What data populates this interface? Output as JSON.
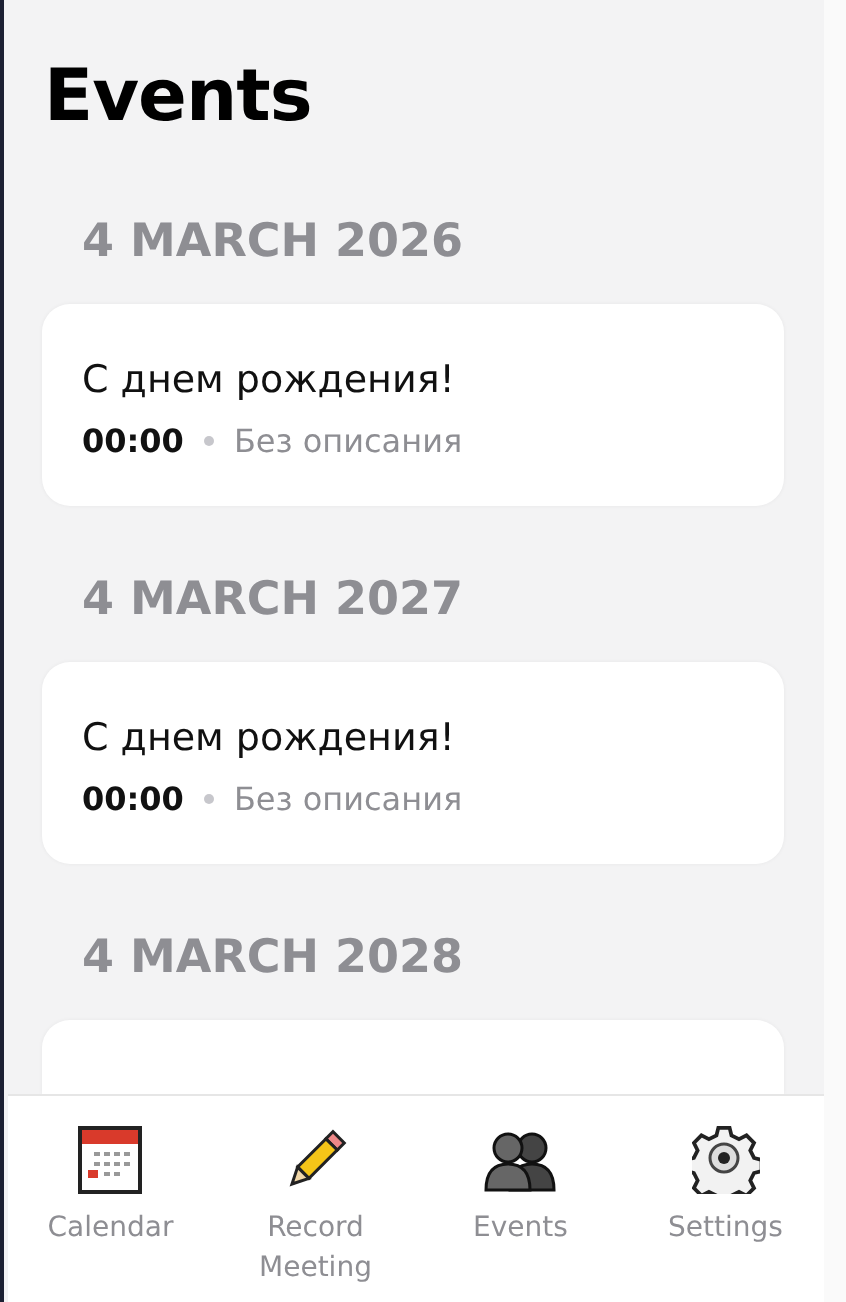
{
  "title": "Events",
  "sections": [
    {
      "date": "4 MARCH 2026",
      "events": [
        {
          "title": "С днем рождения!",
          "time": "00:00",
          "description": "Без описания"
        }
      ]
    },
    {
      "date": "4 MARCH 2027",
      "events": [
        {
          "title": "С днем рождения!",
          "time": "00:00",
          "description": "Без описания"
        }
      ]
    },
    {
      "date": "4 MARCH 2028",
      "events": [
        {
          "kind": "covered"
        }
      ]
    }
  ],
  "tab_bar": [
    {
      "kind": "calendar",
      "label": "Calendar"
    },
    {
      "kind": "pencil",
      "label": "Record Meeting"
    },
    {
      "kind": "people",
      "label": "Events"
    },
    {
      "kind": "gear",
      "label": "Settings"
    }
  ]
}
